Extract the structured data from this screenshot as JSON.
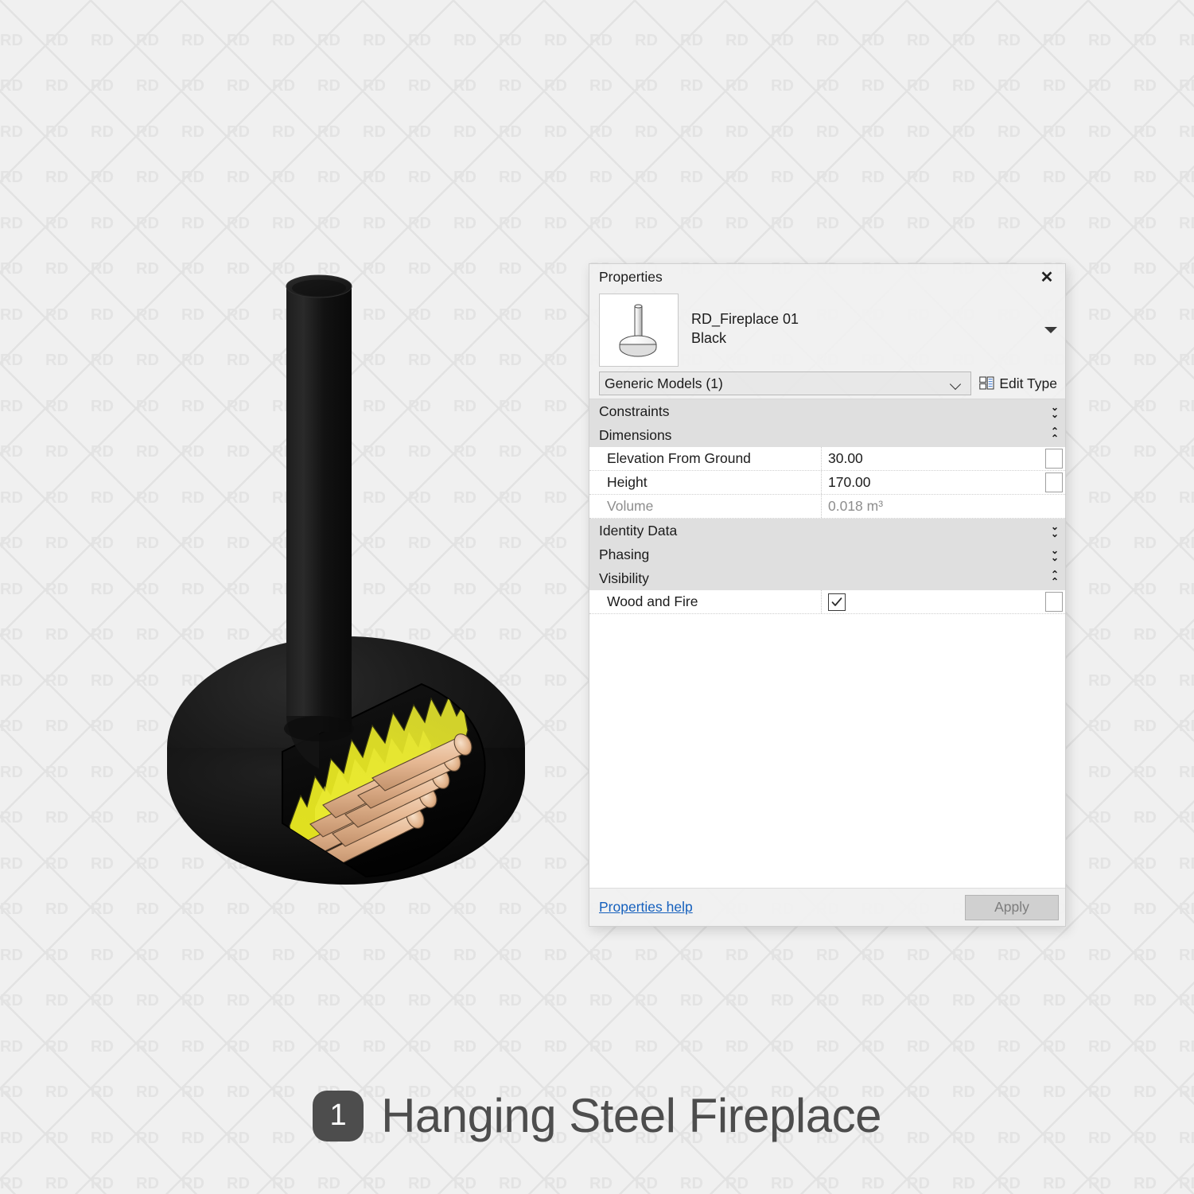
{
  "watermark": {
    "text": "RD"
  },
  "palette": {
    "title": "Properties",
    "close_icon": "close-icon",
    "header": {
      "thumbnail_icon": "fireplace-thumbnail-icon",
      "family_name": "RD_Fireplace 01",
      "type_name": "Black",
      "dropdown_icon": "triangle-down-icon"
    },
    "type_selector": {
      "value": "Generic Models (1)",
      "chevron_icon": "chevron-down-icon"
    },
    "edit_type": {
      "label": "Edit Type",
      "icon": "edit-type-icon"
    },
    "groups": [
      {
        "name": "Constraints",
        "state": "collapsed",
        "toggle_icon": "double-chevron-down-icon",
        "rows": []
      },
      {
        "name": "Dimensions",
        "state": "expanded",
        "toggle_icon": "double-chevron-up-icon",
        "rows": [
          {
            "label": "Elevation From Ground",
            "value": "30.00",
            "type": "text",
            "readonly": false,
            "has_button": true
          },
          {
            "label": "Height",
            "value": "170.00",
            "type": "text",
            "readonly": false,
            "has_button": true
          },
          {
            "label": "Volume",
            "value": "0.018 m³",
            "type": "text",
            "readonly": true,
            "has_button": false
          }
        ]
      },
      {
        "name": "Identity Data",
        "state": "collapsed",
        "toggle_icon": "double-chevron-down-icon",
        "rows": []
      },
      {
        "name": "Phasing",
        "state": "collapsed",
        "toggle_icon": "double-chevron-down-icon",
        "rows": []
      },
      {
        "name": "Visibility",
        "state": "expanded",
        "toggle_icon": "double-chevron-up-icon",
        "rows": [
          {
            "label": "Wood and Fire",
            "value": "",
            "type": "checkbox",
            "checked": true,
            "readonly": false,
            "has_button": true
          }
        ]
      }
    ],
    "footer": {
      "help_link": "Properties help",
      "apply_label": "Apply"
    }
  },
  "model": {
    "name": "hanging-steel-fireplace-3d-model",
    "body_color": "#151515",
    "flue_color": "#1a1a1a",
    "fire_color": "#e8e82a",
    "log_color": "#e7bb94"
  },
  "caption": {
    "number": "1",
    "title": "Hanging Steel Fireplace",
    "badge_color": "#4d4d4d",
    "text_color": "#4d4d4d"
  }
}
